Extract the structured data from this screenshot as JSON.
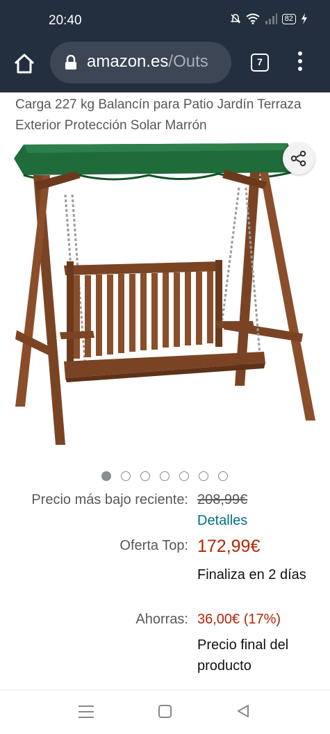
{
  "status_bar": {
    "time": "20:40",
    "battery": "82"
  },
  "browser": {
    "url_domain": "amazon.es",
    "url_path": "/Outs",
    "tab_count": "7"
  },
  "product": {
    "title": "Carga 227 kg Balancín para Patio Jardín Terraza Exterior Protección Solar Marrón",
    "image_count": 7,
    "active_image_index": 0
  },
  "pricing": {
    "recent_low_label": "Precio más bajo reciente:",
    "recent_low_value": "208,99€",
    "details_link": "Detalles",
    "offer_label": "Oferta Top:",
    "offer_price": "172,99€",
    "offer_ends": "Finaliza en 2 días",
    "savings_label": "Ahorras:",
    "savings_value": "36,00€ (17%)",
    "final_price_note": "Precio final del producto"
  },
  "colors": {
    "header_bg": "#232f3e",
    "price_red": "#b12704",
    "link_teal": "#007185",
    "canopy_green": "#1f6b3a",
    "wood_brown": "#7a4424"
  }
}
